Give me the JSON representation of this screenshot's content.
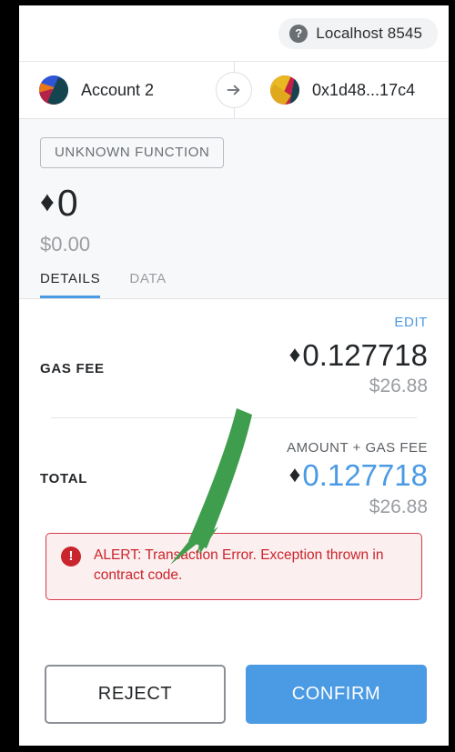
{
  "network": {
    "help_icon": "question-circle-icon",
    "name": "Localhost 8545"
  },
  "accounts": {
    "from": {
      "avatar_icon": "identicon-avatar",
      "label": "Account 2"
    },
    "transfer_icon": "arrow-right-icon",
    "to": {
      "avatar_icon": "identicon-avatar",
      "label": "0x1d48...17c4"
    }
  },
  "summary": {
    "function_badge": "UNKNOWN FUNCTION",
    "eth_symbol": "♦",
    "amount": "0",
    "fiat": "$0.00"
  },
  "tabs": [
    {
      "label": "DETAILS",
      "active": true
    },
    {
      "label": "DATA",
      "active": false
    }
  ],
  "details": {
    "edit_label": "EDIT",
    "gas_fee": {
      "label": "GAS FEE",
      "eth_symbol": "♦",
      "value": "0.127718",
      "fiat": "$26.88"
    },
    "total": {
      "label": "TOTAL",
      "sub_label": "AMOUNT + GAS FEE",
      "eth_symbol": "♦",
      "value": "0.127718",
      "fiat": "$26.88"
    }
  },
  "alert": {
    "icon": "error-exclamation-icon",
    "message": "ALERT: Transaction Error. Exception thrown in contract code."
  },
  "footer": {
    "reject_label": "REJECT",
    "confirm_label": "CONFIRM"
  },
  "annotation": {
    "arrow_icon": "green-pointer-arrow",
    "color": "#3f9e4d"
  },
  "colors": {
    "accent_blue": "#4b9ae4",
    "error_red": "#c9252d",
    "alert_bg": "#fcefef",
    "muted_gray": "#9a9da1",
    "panel_gray": "#f7f8f9"
  }
}
